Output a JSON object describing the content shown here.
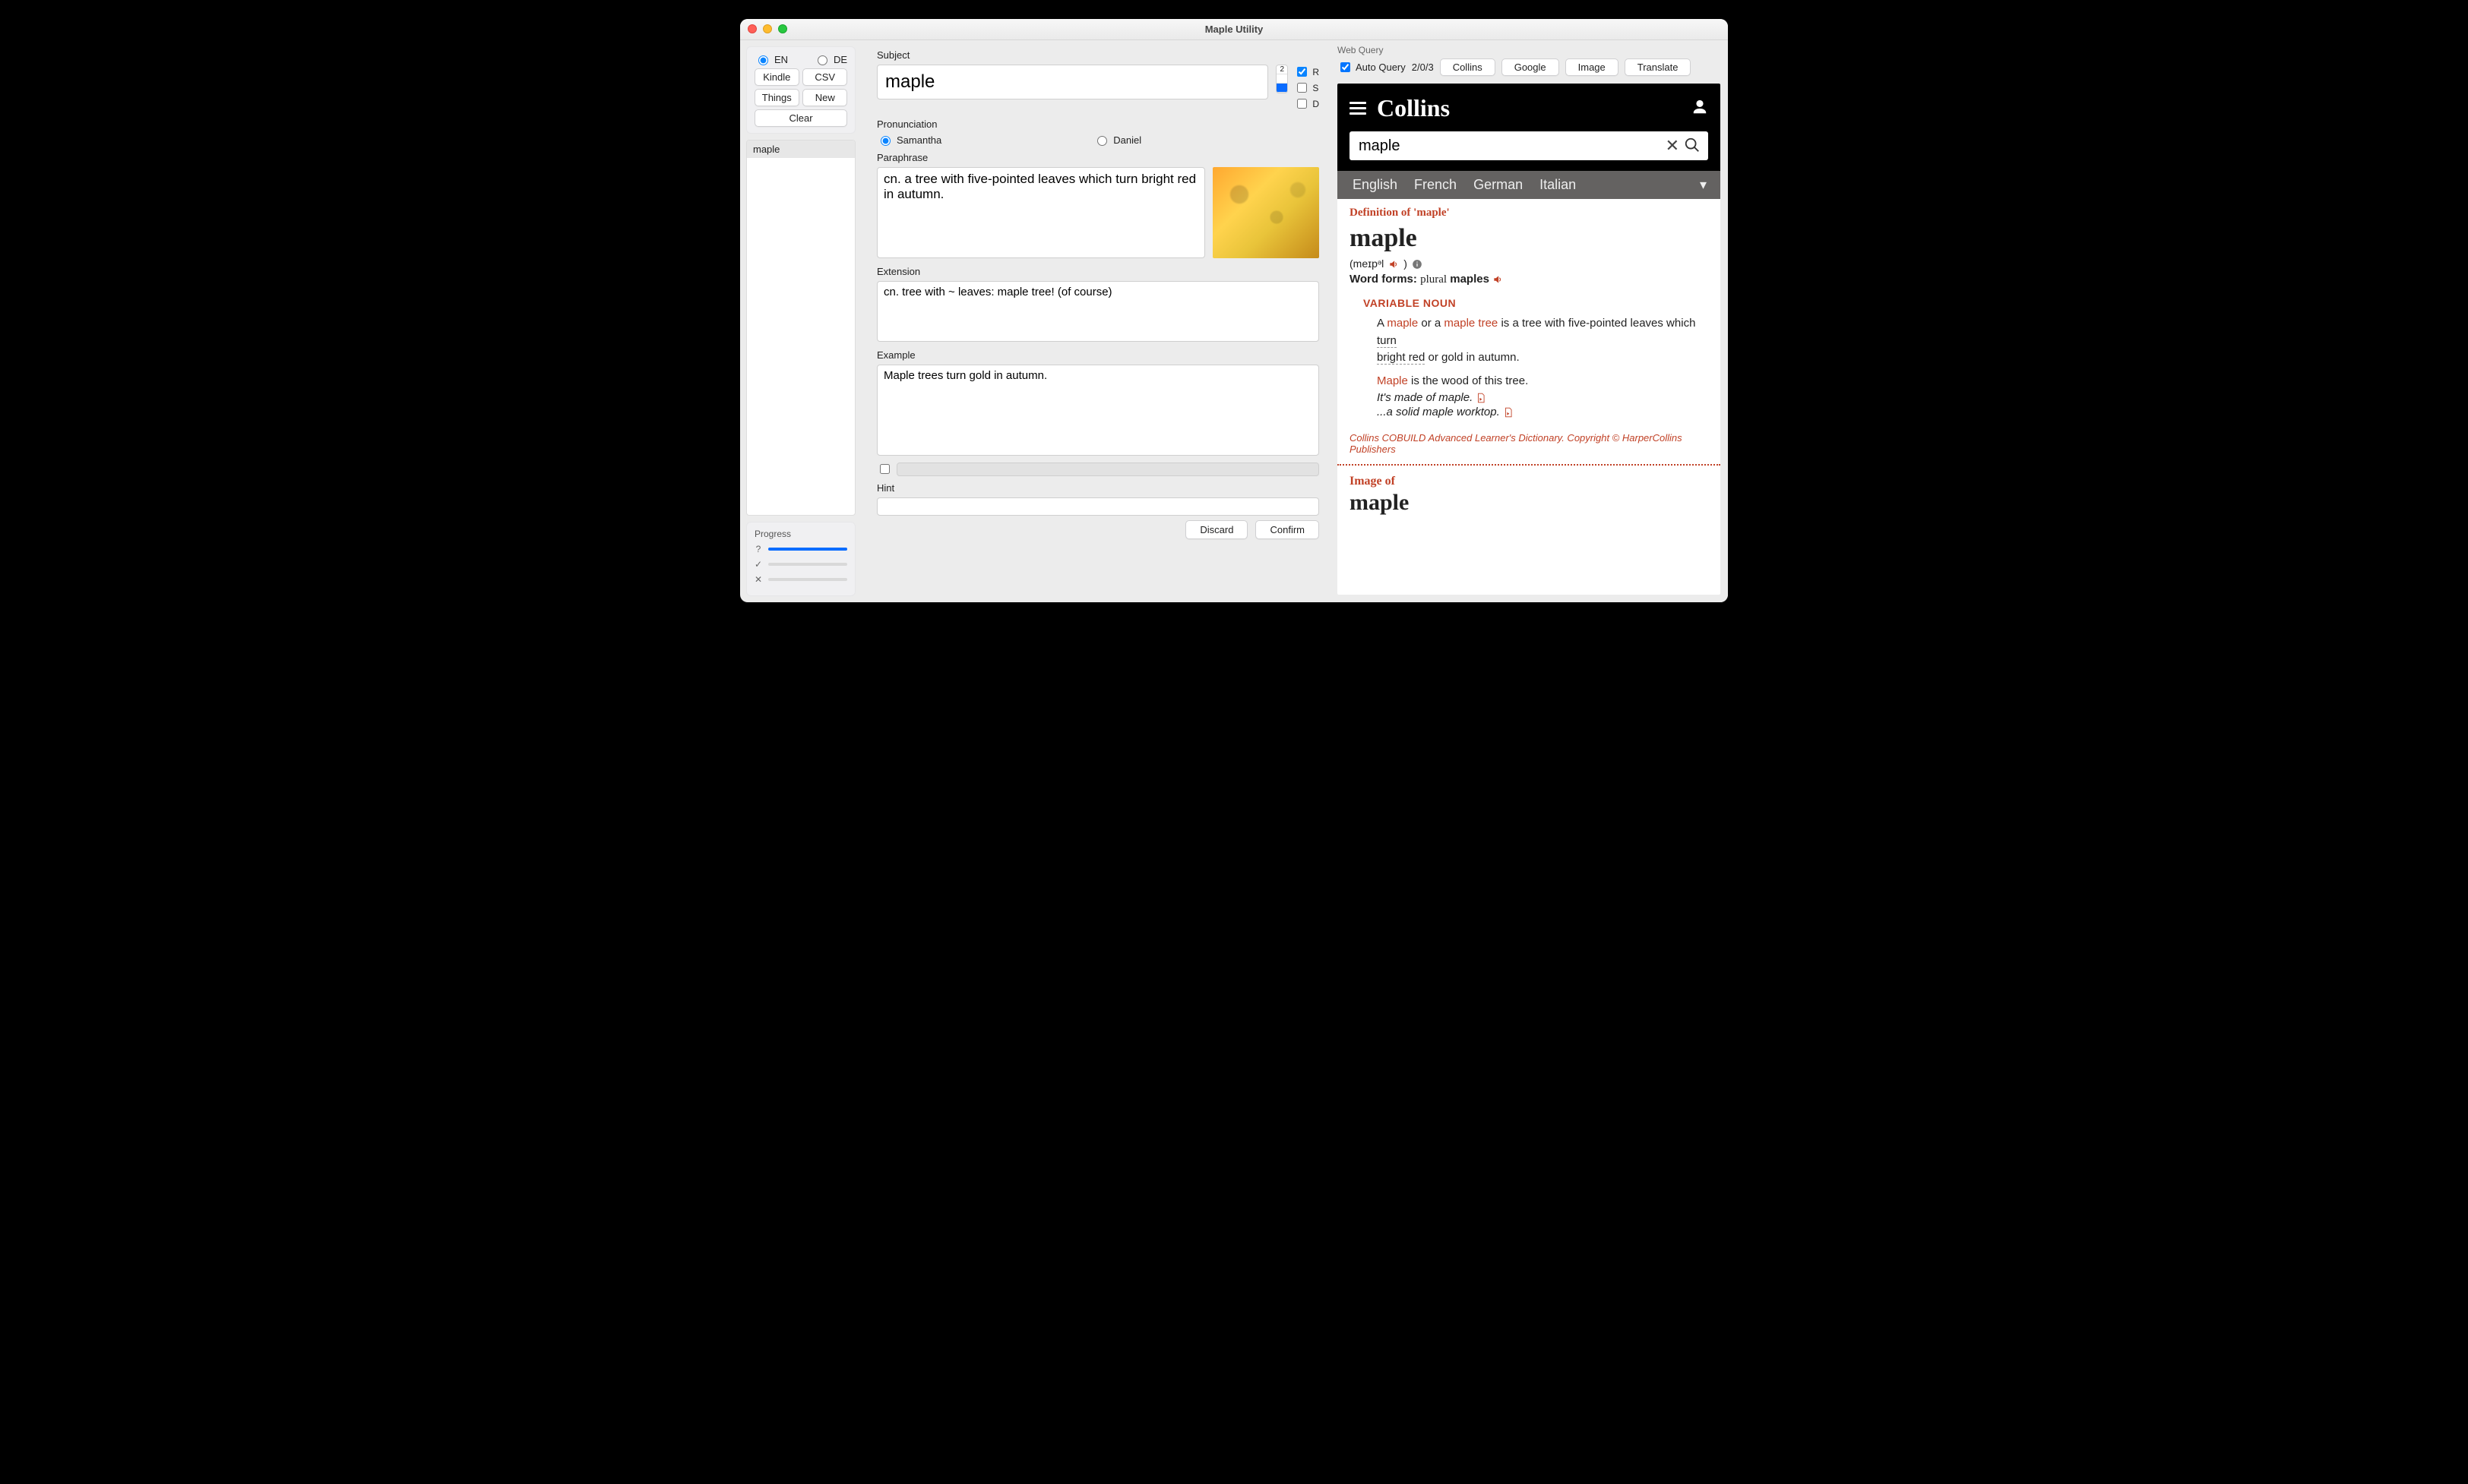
{
  "window": {
    "title": "Maple Utility"
  },
  "sidebar": {
    "lang": {
      "en": "EN",
      "de": "DE",
      "en_selected": true,
      "de_selected": false
    },
    "buttons": {
      "kindle": "Kindle",
      "csv": "CSV",
      "things": "Things",
      "new_": "New",
      "clear": "Clear"
    },
    "words": [
      "maple"
    ],
    "progress_label": "Progress",
    "rows": [
      {
        "sym": "?",
        "pct": 100
      },
      {
        "sym": "✓",
        "pct": 0
      },
      {
        "sym": "✕",
        "pct": 0
      }
    ]
  },
  "form": {
    "subject_label": "Subject",
    "subject_value": "maple",
    "seg_value_top": "2",
    "flags": {
      "r": "R",
      "s": "S",
      "d": "D",
      "r_checked": true,
      "s_checked": false,
      "d_checked": false
    },
    "pron_label": "Pronunciation",
    "pron_options": {
      "samantha": "Samantha",
      "daniel": "Daniel"
    },
    "pron_selected": "samantha",
    "para_label": "Paraphrase",
    "para_value": "cn. a tree with five-pointed leaves which turn bright red in autumn.",
    "ext_label": "Extension",
    "ext_value": "cn. tree with ~ leaves: maple tree! (of course)",
    "example_label": "Example",
    "example_value": "Maple trees turn gold in autumn.",
    "hint_label": "Hint",
    "hint_value": "",
    "discard": "Discard",
    "confirm": "Confirm"
  },
  "webq": {
    "title": "Web Query",
    "auto": "Auto Query",
    "counter": "2/0/3",
    "tabs": {
      "collins": "Collins",
      "google": "Google",
      "image": "Image",
      "translate": "Translate"
    }
  },
  "collins": {
    "logo": "Collins",
    "search_value": "maple",
    "langs": [
      "English",
      "French",
      "German",
      "Italian"
    ],
    "def_heading": "Definition of 'maple'",
    "headword": "maple",
    "ipa": "(meɪpᵊl ",
    "forms_label": "Word forms:",
    "forms_plural_label": "plural",
    "forms_value": "maples",
    "pos": "VARIABLE NOUN",
    "def_pre_a": "A ",
    "def_w1": "maple",
    "def_mid": " or a ",
    "def_w2": "maple tree",
    "def_post": " is a tree with five-pointed leaves which ",
    "def_turn": "turn",
    "def_line2a": "bright red",
    "def_line2b": " or gold in autumn.",
    "sense2_w": "Maple",
    "sense2_rest": " is the wood of this tree.",
    "ex1": "It's made of maple.",
    "ex2": "...a solid maple worktop.",
    "copyright": "Collins COBUILD Advanced Learner's Dictionary. Copyright © HarperCollins Publishers",
    "image_of": "Image of",
    "image_word": "maple"
  }
}
